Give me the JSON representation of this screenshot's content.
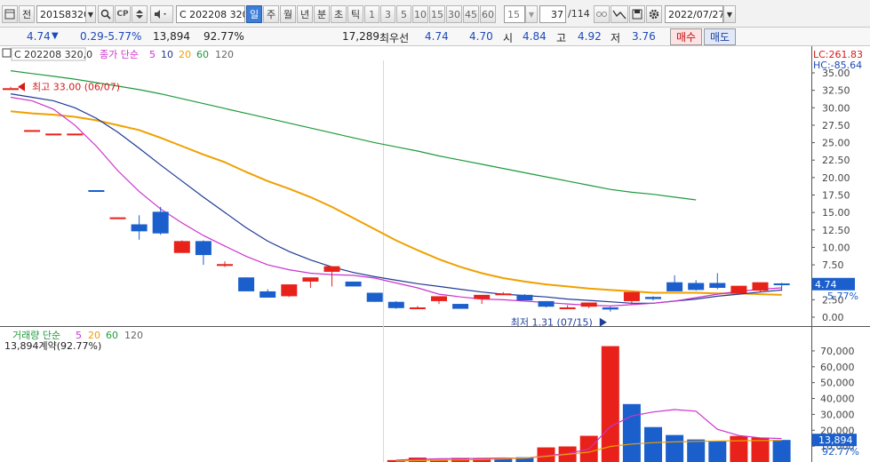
{
  "toolbar": {
    "tab_label": "전",
    "code": "201S8320",
    "option_name": "C 202208 320",
    "periods": [
      "일",
      "주",
      "월",
      "년",
      "분",
      "초",
      "틱"
    ],
    "active_period": "일",
    "intervals": [
      "1",
      "3",
      "5",
      "10",
      "15",
      "30",
      "45",
      "60"
    ],
    "interval_value": "15",
    "count_current": "37",
    "count_total": "/114",
    "date": "2022/07/27"
  },
  "info": {
    "price": "4.74",
    "change": "0.29",
    "rate": "-5.77%",
    "volume": "13,894",
    "volume_ratio": "92.77%",
    "best_qty": "17,289",
    "best_label": "최우선",
    "best_ask": "4.74",
    "best_bid": "4.70",
    "open_label": "시",
    "open": "4.84",
    "high_label": "고",
    "high": "4.92",
    "low_label": "저",
    "low": "3.76",
    "buy_label": "매수",
    "sell_label": "매도"
  },
  "price_panel": {
    "instrument": "C 202208 320,0",
    "ma_title": "종가 단순",
    "ma_periods": [
      "5",
      "10",
      "20",
      "60",
      "120"
    ],
    "lc": "LC:261.83",
    "hc": "HC:-85.64",
    "high_note": "최고 33.00 (06/07)",
    "low_note": "최저 1.31 (07/15)",
    "last_price_tag": "4.74",
    "last_rate_tag": "-5.77%",
    "y_ticks": [
      "35.00",
      "32.50",
      "30.00",
      "27.50",
      "25.00",
      "22.50",
      "20.00",
      "17.50",
      "15.00",
      "12.50",
      "10.00",
      "7.50",
      "5.00",
      "2.50",
      "0.00"
    ]
  },
  "volume_panel": {
    "title": "거래량 단순",
    "ma_periods": [
      "5",
      "20",
      "60",
      "120"
    ],
    "info_line": "13,894계약(92.77%)",
    "last_volume_tag": "13,894",
    "last_ratio_tag": "92.77%",
    "y_ticks": [
      "70,000",
      "60,000",
      "50,000",
      "40,000",
      "30,000",
      "20,000",
      "10,000"
    ]
  },
  "colors": {
    "up": "#e8211a",
    "down": "#1b5fcc",
    "ma5": "#cc33cc",
    "ma10": "#1f3a93",
    "ma20": "#f0a000",
    "ma60": "#1e9a3c",
    "ma120": "#666666"
  },
  "chart_data": {
    "type": "candlestick",
    "candles": [
      {
        "o": 32.8,
        "h": 33.0,
        "l": 32.8,
        "c": 32.8
      },
      {
        "o": 26.8,
        "h": 26.8,
        "l": 26.8,
        "c": 26.8
      },
      {
        "o": 26.3,
        "h": 26.3,
        "l": 26.3,
        "c": 26.3
      },
      {
        "o": 26.3,
        "h": 26.3,
        "l": 26.3,
        "c": 26.3
      },
      {
        "o": 18.2,
        "h": 18.2,
        "l": 18.1,
        "c": 18.1
      },
      {
        "o": 14.3,
        "h": 14.3,
        "l": 14.2,
        "c": 14.3
      },
      {
        "o": 13.3,
        "h": 14.6,
        "l": 11.1,
        "c": 12.3
      },
      {
        "o": 15.1,
        "h": 15.8,
        "l": 11.8,
        "c": 12.0
      },
      {
        "o": 9.2,
        "h": 11.0,
        "l": 9.2,
        "c": 10.9
      },
      {
        "o": 10.9,
        "h": 11.0,
        "l": 7.5,
        "c": 8.9
      },
      {
        "o": 7.6,
        "h": 8.0,
        "l": 7.2,
        "c": 7.6
      },
      {
        "o": 5.7,
        "h": 5.7,
        "l": 5.3,
        "c": 3.7
      },
      {
        "o": 3.7,
        "h": 4.0,
        "l": 2.8,
        "c": 2.8
      },
      {
        "o": 3.0,
        "h": 4.7,
        "l": 2.9,
        "c": 4.7
      },
      {
        "o": 5.1,
        "h": 5.5,
        "l": 4.2,
        "c": 5.7
      },
      {
        "o": 6.5,
        "h": 7.0,
        "l": 4.4,
        "c": 7.3
      },
      {
        "o": 5.1,
        "h": 5.1,
        "l": 4.4,
        "c": 4.4
      },
      {
        "o": 3.5,
        "h": 3.5,
        "l": 2.2,
        "c": 2.2
      },
      {
        "o": 2.2,
        "h": 2.3,
        "l": 1.2,
        "c": 1.3
      },
      {
        "o": 1.4,
        "h": 1.6,
        "l": 1.3,
        "c": 1.4
      },
      {
        "o": 2.3,
        "h": 2.4,
        "l": 1.9,
        "c": 3.0
      },
      {
        "o": 1.9,
        "h": 1.9,
        "l": 1.2,
        "c": 1.2
      },
      {
        "o": 2.6,
        "h": 2.6,
        "l": 1.9,
        "c": 3.2
      },
      {
        "o": 3.2,
        "h": 3.6,
        "l": 3.2,
        "c": 3.4
      },
      {
        "o": 3.2,
        "h": 3.3,
        "l": 2.4,
        "c": 2.4
      },
      {
        "o": 2.3,
        "h": 2.3,
        "l": 1.4,
        "c": 1.5
      },
      {
        "o": 1.4,
        "h": 1.7,
        "l": 1.3,
        "c": 1.4
      },
      {
        "o": 1.5,
        "h": 1.6,
        "l": 1.3,
        "c": 2.1
      },
      {
        "o": 1.4,
        "h": 1.5,
        "l": 0.8,
        "c": 1.1
      },
      {
        "o": 2.3,
        "h": 3.0,
        "l": 1.8,
        "c": 3.6
      },
      {
        "o": 2.9,
        "h": 3.0,
        "l": 2.4,
        "c": 2.6
      },
      {
        "o": 5.0,
        "h": 6.0,
        "l": 3.7,
        "c": 3.7
      },
      {
        "o": 4.9,
        "h": 5.3,
        "l": 3.8,
        "c": 3.9
      },
      {
        "o": 4.9,
        "h": 6.3,
        "l": 4.0,
        "c": 4.2
      },
      {
        "o": 3.4,
        "h": 4.3,
        "l": 3.3,
        "c": 4.5
      },
      {
        "o": 3.8,
        "h": 4.7,
        "l": 3.6,
        "c": 5.0
      },
      {
        "o": 4.84,
        "h": 4.92,
        "l": 3.76,
        "c": 4.74
      }
    ],
    "ma5": [
      31.5,
      31.0,
      29.8,
      27.5,
      24.5,
      21.0,
      18.0,
      15.5,
      13.5,
      11.7,
      10.2,
      8.7,
      7.5,
      6.8,
      6.3,
      6.1,
      6.0,
      5.6,
      4.9,
      4.2,
      3.3,
      2.9,
      2.6,
      2.5,
      2.3,
      2.1,
      1.9,
      1.7,
      1.6,
      1.8,
      2.0,
      2.3,
      2.8,
      3.3,
      3.7,
      4.0,
      4.2
    ],
    "ma10": [
      32.0,
      31.5,
      31.0,
      30.0,
      28.5,
      26.5,
      24.2,
      21.8,
      19.5,
      17.2,
      15.0,
      12.8,
      10.9,
      9.4,
      8.2,
      7.2,
      6.4,
      5.8,
      5.3,
      4.8,
      4.4,
      4.0,
      3.6,
      3.3,
      3.1,
      2.9,
      2.6,
      2.4,
      2.2,
      2.0,
      2.0,
      2.3,
      2.6,
      3.0,
      3.3,
      3.6,
      3.9
    ],
    "ma20": [
      29.5,
      29.2,
      29.0,
      28.7,
      28.2,
      27.5,
      26.8,
      25.7,
      24.5,
      23.3,
      22.2,
      20.8,
      19.5,
      18.4,
      17.2,
      15.8,
      14.2,
      12.6,
      11.0,
      9.6,
      8.3,
      7.2,
      6.3,
      5.6,
      5.1,
      4.7,
      4.4,
      4.1,
      3.9,
      3.7,
      3.5,
      3.5,
      3.5,
      3.4,
      3.4,
      3.3,
      3.2
    ],
    "ma60": [
      35.3,
      34.9,
      34.5,
      34.1,
      33.6,
      33.1,
      32.6,
      32.0,
      31.3,
      30.6,
      29.9,
      29.2,
      28.5,
      27.8,
      27.1,
      26.4,
      25.7,
      25.0,
      24.4,
      23.8,
      23.1,
      22.5,
      21.9,
      21.3,
      20.7,
      20.1,
      19.5,
      18.9,
      18.3,
      17.9,
      17.6,
      17.2,
      16.8
    ],
    "volume": [
      0,
      0,
      0,
      0,
      0,
      0,
      0,
      0,
      0,
      0,
      0,
      0,
      0,
      0,
      0,
      0,
      0,
      0,
      1200,
      2800,
      1500,
      2600,
      2400,
      2200,
      3000,
      9200,
      9800,
      16500,
      73000,
      36500,
      22000,
      17000,
      14200,
      13200,
      16400,
      15400,
      13894
    ],
    "volume_dir": [
      0,
      0,
      0,
      0,
      0,
      0,
      0,
      0,
      0,
      0,
      0,
      0,
      0,
      0,
      0,
      0,
      0,
      0,
      1,
      1,
      1,
      1,
      1,
      0,
      0,
      1,
      1,
      1,
      1,
      0,
      0,
      0,
      0,
      0,
      1,
      1,
      0
    ],
    "vol_ma5": [
      null,
      null,
      null,
      null,
      null,
      null,
      null,
      null,
      null,
      null,
      null,
      null,
      null,
      null,
      null,
      null,
      null,
      null,
      1200,
      1700,
      2000,
      2100,
      2300,
      2500,
      2400,
      3900,
      5300,
      8100,
      22300,
      29000,
      31500,
      33000,
      32000,
      20600,
      16700,
      15200,
      14800
    ],
    "vol_ma20": [
      null,
      null,
      null,
      null,
      null,
      null,
      null,
      null,
      null,
      null,
      null,
      null,
      null,
      null,
      null,
      null,
      null,
      null,
      600,
      900,
      1100,
      1300,
      1500,
      2000,
      2500,
      3500,
      4800,
      6200,
      9800,
      11300,
      12200,
      12700,
      13000,
      13200,
      13400,
      13500,
      13600
    ],
    "ylim_price": [
      0,
      35
    ],
    "ylim_volume": [
      0,
      75000
    ]
  }
}
